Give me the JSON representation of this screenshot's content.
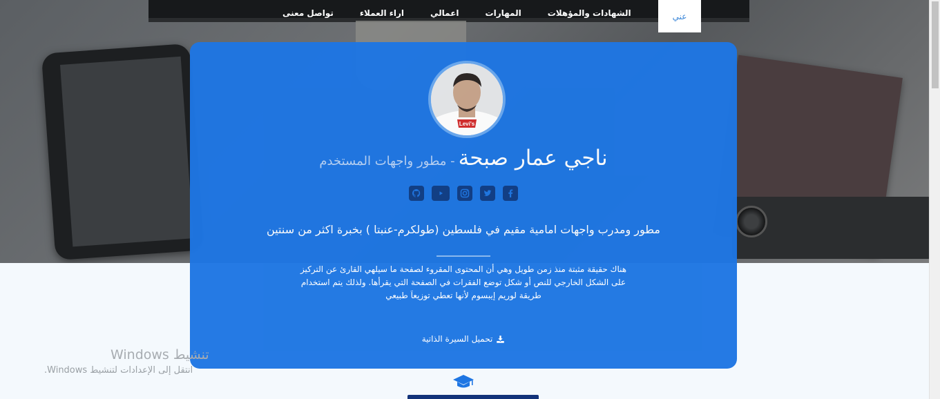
{
  "nav": {
    "items": [
      {
        "label": "عني",
        "active": true
      },
      {
        "label": "الشهادات والمؤهلات",
        "active": false
      },
      {
        "label": "المهارات",
        "active": false
      },
      {
        "label": "اعمالي",
        "active": false
      },
      {
        "label": "اراء العملاء",
        "active": false
      },
      {
        "label": "تواصل معنى",
        "active": false
      }
    ]
  },
  "profile": {
    "name": "ناجي عمار صبحة",
    "role": "- مطور واجهات المستخدم",
    "avatar_shirt_text": "Levi's",
    "headline": "مطور ومدرب واجهات امامية مقيم في فلسطين (طولكرم-عنبتا ) بخبرة اكثر من سنتين",
    "bio_lines": [
      "هناك حقيقة مثبتة منذ زمن طويل وهي أن المحتوى المقروء لصفحة ما سيلهي القارئ عن التركيز",
      "على الشكل الخارجي للنص أو شكل توضع الفقرات في الصفحة التي يقرأها. ولذلك يتم استخدام",
      "طريقة لوريم إيبسوم لأنها تعطي توزيعاَ طبيعي"
    ],
    "cv_label": "تحميل السيرة الذاتية"
  },
  "socials": [
    {
      "icon": "facebook-icon"
    },
    {
      "icon": "twitter-icon"
    },
    {
      "icon": "instagram-icon"
    },
    {
      "icon": "youtube-icon"
    },
    {
      "icon": "github-icon"
    }
  ],
  "windows_watermark": {
    "title": "تنشيط Windows",
    "subtitle": "انتقل إلى الإعدادات لتنشيط Windows."
  },
  "colors": {
    "card": "#1e76e3",
    "icon": "#103e86",
    "nav_active_text": "#3a86d8"
  }
}
